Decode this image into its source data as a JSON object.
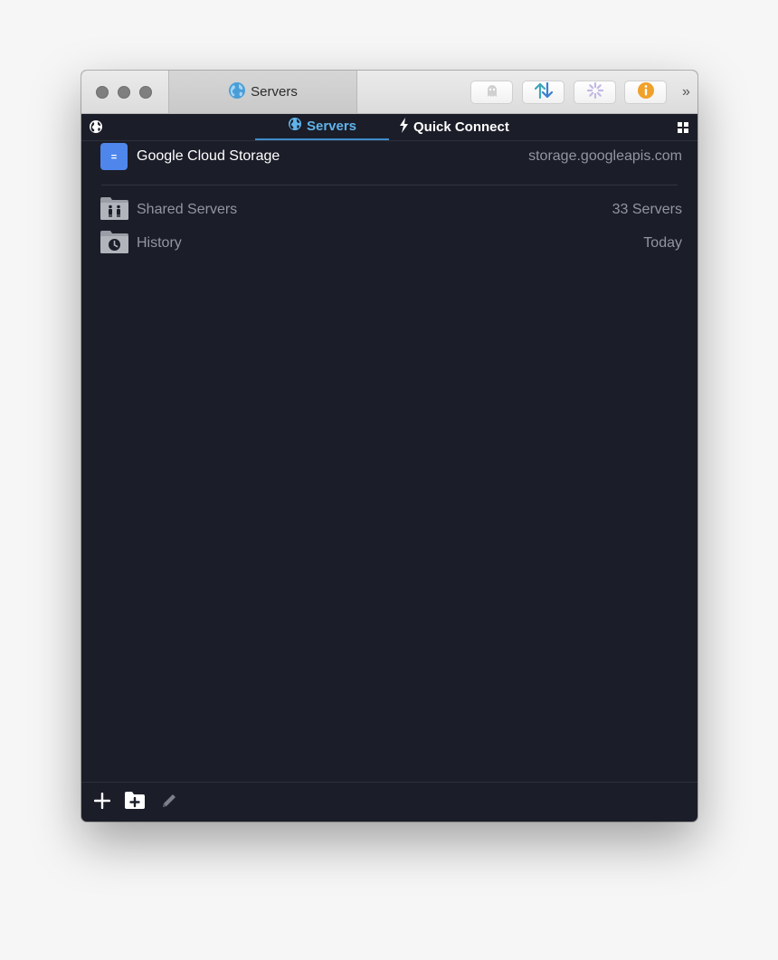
{
  "window": {
    "title": "Servers",
    "accent_color": "#5fb3ea",
    "background_color": "#1b1d28"
  },
  "toolbar": {
    "buttons": [
      {
        "name": "ghost",
        "icon": "ghost-icon"
      },
      {
        "name": "transfers",
        "icon": "up-down-arrows-icon"
      },
      {
        "name": "activity",
        "icon": "spinner-icon"
      },
      {
        "name": "info",
        "icon": "info-icon"
      }
    ],
    "overflow": "»"
  },
  "nav": {
    "tabs": [
      {
        "label": "Servers",
        "icon": "globe-icon",
        "selected": true
      },
      {
        "label": "Quick Connect",
        "icon": "lightning-icon",
        "selected": false
      }
    ]
  },
  "servers": {
    "bookmark": {
      "name": "Google Cloud Storage",
      "host": "storage.googleapis.com",
      "badge": "="
    },
    "shared": {
      "name": "Shared Servers",
      "detail": "33 Servers"
    },
    "history": {
      "name": "History",
      "detail": "Today"
    }
  },
  "footer": {
    "buttons": [
      {
        "name": "add",
        "icon": "plus-icon"
      },
      {
        "name": "new-folder",
        "icon": "folder-plus-icon"
      },
      {
        "name": "edit",
        "icon": "pencil-icon"
      }
    ]
  }
}
